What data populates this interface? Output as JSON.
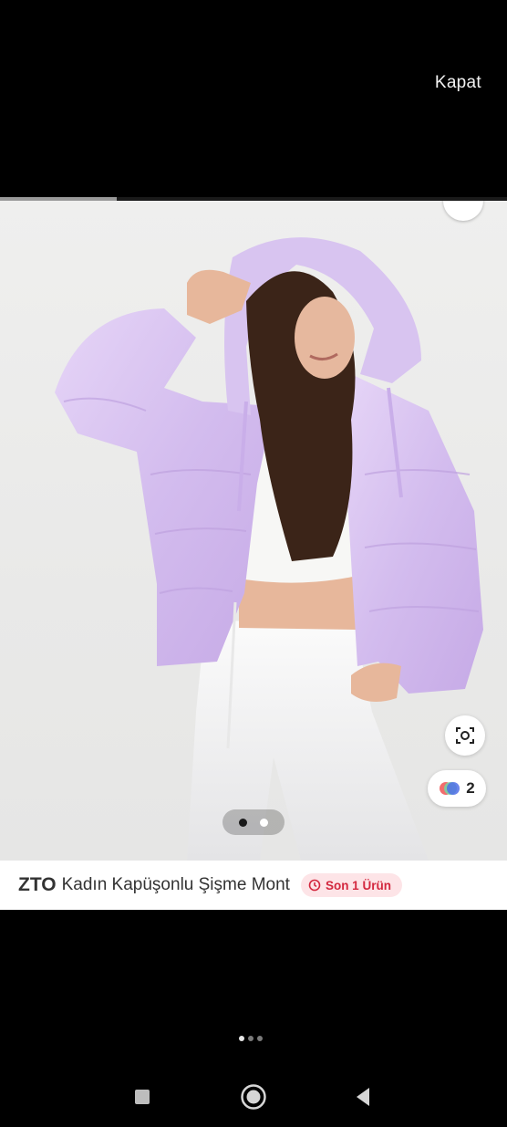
{
  "header": {
    "close_label": "Kapat"
  },
  "story_progress": {
    "segments": 1,
    "fill_fraction": 0.23
  },
  "image": {
    "subject": "woman wearing lilac hooded puffer jacket, white crop top and white jeans",
    "jacket_color": "#d7c2ef",
    "background_color": "#ececeb",
    "carousel": {
      "total": 2,
      "active_index": 0
    },
    "variant_count": "2"
  },
  "product": {
    "brand": "ZTO",
    "name": "Kadın Kapüşonlu Şişme Mont",
    "stock_badge": "Son 1 Ürün"
  },
  "page_indicator": {
    "total": 3,
    "active_index": 0
  },
  "icons": [
    "visual-search-icon",
    "color-variants-icon",
    "clock-icon",
    "recents-icon",
    "home-icon",
    "back-icon"
  ],
  "colors": {
    "badge_bg": "#fde4e7",
    "badge_text": "#d3273e"
  }
}
